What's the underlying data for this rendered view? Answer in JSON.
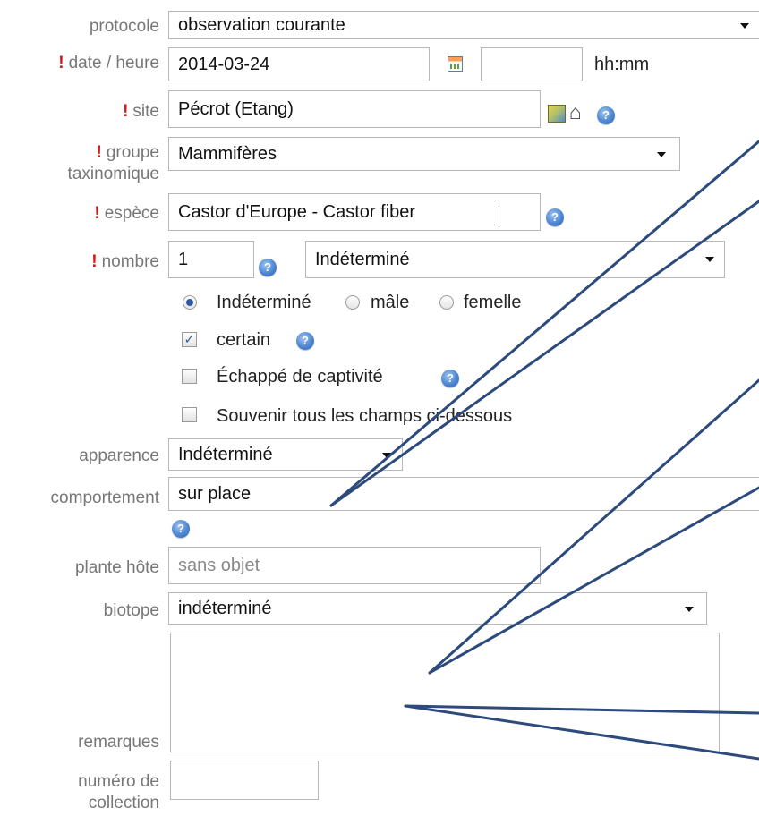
{
  "form": {
    "protocole": {
      "label": "protocole",
      "value": "observation courante"
    },
    "date": {
      "required_mark": "!",
      "label": "date / heure",
      "date_value": "2014-03-24",
      "time_value": "",
      "time_unit": "hh:mm"
    },
    "site": {
      "required_mark": "!",
      "label": "site",
      "value": "Pécrot (Etang)"
    },
    "groupe": {
      "required_mark": "!",
      "label_line1": "groupe",
      "label_line2": "taxinomique",
      "value": "Mammifères"
    },
    "espece": {
      "required_mark": "!",
      "label": "espèce",
      "value": "Castor d'Europe - Castor fiber"
    },
    "nombre": {
      "required_mark": "!",
      "label": "nombre",
      "count_value": "1",
      "precision_value": "Indéterminé"
    },
    "sexe": {
      "selected": "Indéterminé",
      "options": [
        "Indéterminé",
        "mâle",
        "femelle"
      ]
    },
    "checks": {
      "certain": {
        "label": "certain",
        "checked": true
      },
      "echappe": {
        "label": "Échappé de captivité",
        "checked": false
      },
      "souvenir": {
        "label": "Souvenir tous les champs ci-dessous",
        "checked": false
      }
    },
    "apparence": {
      "label": "apparence",
      "value": "Indéterminé"
    },
    "comportement": {
      "label": "comportement",
      "value": "sur place"
    },
    "plante": {
      "label": "plante hôte",
      "placeholder": "sans objet"
    },
    "biotope": {
      "label": "biotope",
      "value": "indéterminé"
    },
    "remarques": {
      "label": "remarques",
      "value": ""
    },
    "collection": {
      "label_line1": "numéro de",
      "label_line2": "collection",
      "value": ""
    }
  },
  "annotation": {
    "color": "#2c4a7c"
  },
  "icons": {
    "help": "help-icon",
    "calendar": "calendar-icon",
    "map": "map-icon",
    "home": "home-icon",
    "dropdown": "chevron-down-icon"
  }
}
